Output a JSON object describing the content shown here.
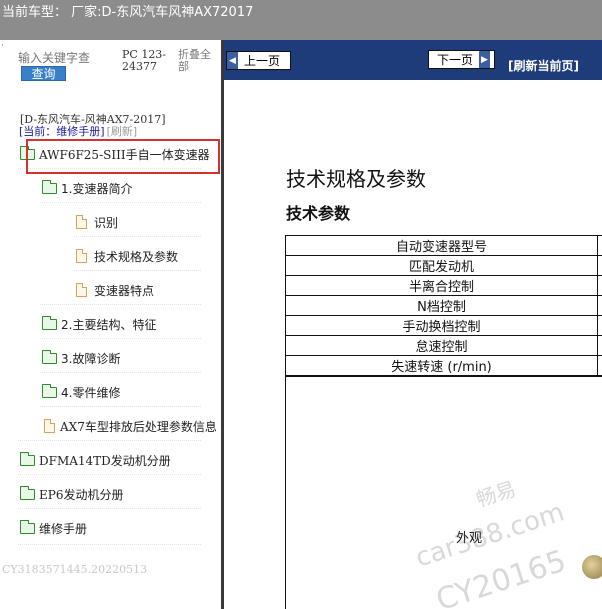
{
  "header": {
    "current_model": "当前车型：  厂家:D-东风汽车风神AX72017"
  },
  "sidebar": {
    "search_placeholder": "输入关键字查",
    "search_button": "查询",
    "pc_text": "PC 123-24377",
    "collapse_all": "折叠全部",
    "marker": "·",
    "manual_title": "[D-东风汽车-风神AX7-2017]",
    "current_label": "[当前：维修手册]",
    "refresh_label": "[刷新]",
    "tree": [
      {
        "label": "AWF6F25-SIII手自一体变速器",
        "type": "folder"
      },
      {
        "label": "1.变速器简介",
        "type": "folder"
      },
      {
        "label": "识别",
        "type": "page"
      },
      {
        "label": "技术规格及参数",
        "type": "page"
      },
      {
        "label": "变速器特点",
        "type": "page"
      },
      {
        "label": "2.主要结构、特征",
        "type": "folder"
      },
      {
        "label": "3.故障诊断",
        "type": "folder"
      },
      {
        "label": "4.零件维修",
        "type": "folder"
      },
      {
        "label": "AX7车型排放后处理参数信息",
        "type": "page"
      },
      {
        "label": "DFMA14TD发动机分册",
        "type": "folder"
      },
      {
        "label": "EP6发动机分册",
        "type": "folder"
      },
      {
        "label": "维修手册",
        "type": "folder"
      }
    ],
    "footer_id": "CY3183571445.20220513"
  },
  "content": {
    "prev_button": "上一页",
    "next_button": "下一页",
    "refresh_current": "[刷新当前页]",
    "title": "技术规格及参数",
    "subtitle": "技术参数",
    "table_rows": [
      "自动变速器型号",
      "匹配发动机",
      "半离合控制",
      "N档控制",
      "手动换档控制",
      "怠速控制",
      "失速转速 (r/min)"
    ],
    "appearance_label": "外观"
  },
  "watermark": {
    "line1": "畅易",
    "line2": "car388.com",
    "line3": "CY20165"
  },
  "colors": {
    "top_bar": "#8c8c8c",
    "toolbar": "#1e3c7a",
    "highlight": "#d63031",
    "folder": "#2e8b2e",
    "page": "#d7a35a"
  }
}
